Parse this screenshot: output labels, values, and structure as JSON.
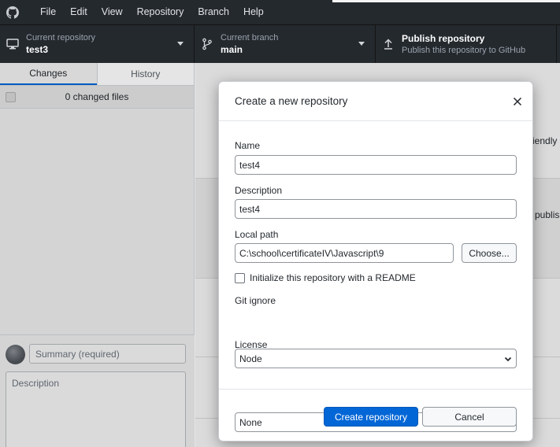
{
  "menu": {
    "items": [
      "File",
      "Edit",
      "View",
      "Repository",
      "Branch",
      "Help"
    ]
  },
  "toolbar": {
    "repository": {
      "label": "Current repository",
      "value": "test3"
    },
    "branch": {
      "label": "Current branch",
      "value": "main"
    },
    "publish": {
      "label": "Publish repository",
      "subtitle": "Publish this repository to GitHub"
    }
  },
  "sidebar": {
    "tabs": {
      "changes": "Changes",
      "history": "History"
    },
    "changed_files": "0 changed files",
    "summary_placeholder": "Summary (required)",
    "description_placeholder": "Description"
  },
  "main": {
    "peek_1": "iendly",
    "peek_2": "publis"
  },
  "dialog": {
    "title": "Create a new repository",
    "name_label": "Name",
    "name_value": "test4",
    "description_label": "Description",
    "description_value": "test4",
    "local_path_label": "Local path",
    "local_path_value": "C:\\school\\certificateIV\\Javascript\\9",
    "choose_label": "Choose...",
    "readme_label": "Initialize this repository with a README",
    "readme_checked": false,
    "gitignore_label": "Git ignore",
    "gitignore_value": "Node",
    "license_label": "License",
    "license_value": "None",
    "create_label": "Create repository",
    "cancel_label": "Cancel"
  },
  "colors": {
    "titlebar": "#24292e",
    "accent": "#0366d6"
  }
}
